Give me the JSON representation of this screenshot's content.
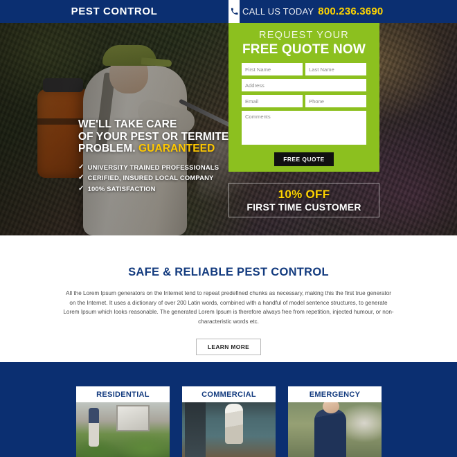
{
  "header": {
    "logo": "PEST CONTROL",
    "phone_icon": "phone-icon",
    "call_label": "CALL US TODAY",
    "call_number": "800.236.3690",
    "bg_color": "#0b2f71",
    "number_color": "#ffd400"
  },
  "hero": {
    "headline_line1": "WE'LL TAKE CARE",
    "headline_line2": "OF YOUR PEST OR TERMITE",
    "headline_line3_plain": "PROBLEM. ",
    "headline_line3_accent": "GUARANTEED",
    "accent_color": "#ffc800",
    "bullets": [
      {
        "tick": "✓",
        "label": "UNIVERSITY TRAINED PROFESSIONALS"
      },
      {
        "tick": "✓",
        "label": "CERIFIED, INSURED LOCAL COMPANY"
      },
      {
        "tick": "✓",
        "label": "100% SATISFACTION"
      }
    ]
  },
  "form": {
    "title_small": "REQUEST YOUR",
    "title_big": "FREE QUOTE NOW",
    "panel_color": "#8cc01f",
    "fields": {
      "first_name": {
        "placeholder": "First Name",
        "value": ""
      },
      "last_name": {
        "placeholder": "Last Name",
        "value": ""
      },
      "address": {
        "placeholder": "Address",
        "value": ""
      },
      "email": {
        "placeholder": "Email",
        "value": ""
      },
      "phone": {
        "placeholder": "Phone",
        "value": ""
      },
      "comments": {
        "placeholder": "Comments",
        "value": ""
      }
    },
    "submit_label": "FREE QUOTE"
  },
  "offer": {
    "discount": "10% OFF",
    "subtitle": "FIRST TIME CUSTOMER",
    "discount_color": "#ffd400"
  },
  "about": {
    "title": "SAFE & RELIABLE PEST CONTROL",
    "title_color": "#123a7e",
    "body": "All the Lorem Ipsum generators on the Internet tend to repeat predefined chunks as necessary, making this the first true generator on the Internet. It uses a dictionary of over 200 Latin words, combined with a handful of model sentence structures, to generate Lorem Ipsum which looks reasonable. The generated Lorem Ipsum is therefore always free from repetition, injected humour, or non-characteristic words etc.",
    "cta_label": "LEARN MORE"
  },
  "services": {
    "bg_color": "#0b2f71",
    "cards": [
      {
        "title": "RESIDENTIAL",
        "image": "technician-spraying-house-exterior"
      },
      {
        "title": "COMMERCIAL",
        "image": "technician-spraying-commercial-kitchen"
      },
      {
        "title": "EMERGENCY",
        "image": "smiling-technician-at-doorway"
      }
    ]
  }
}
